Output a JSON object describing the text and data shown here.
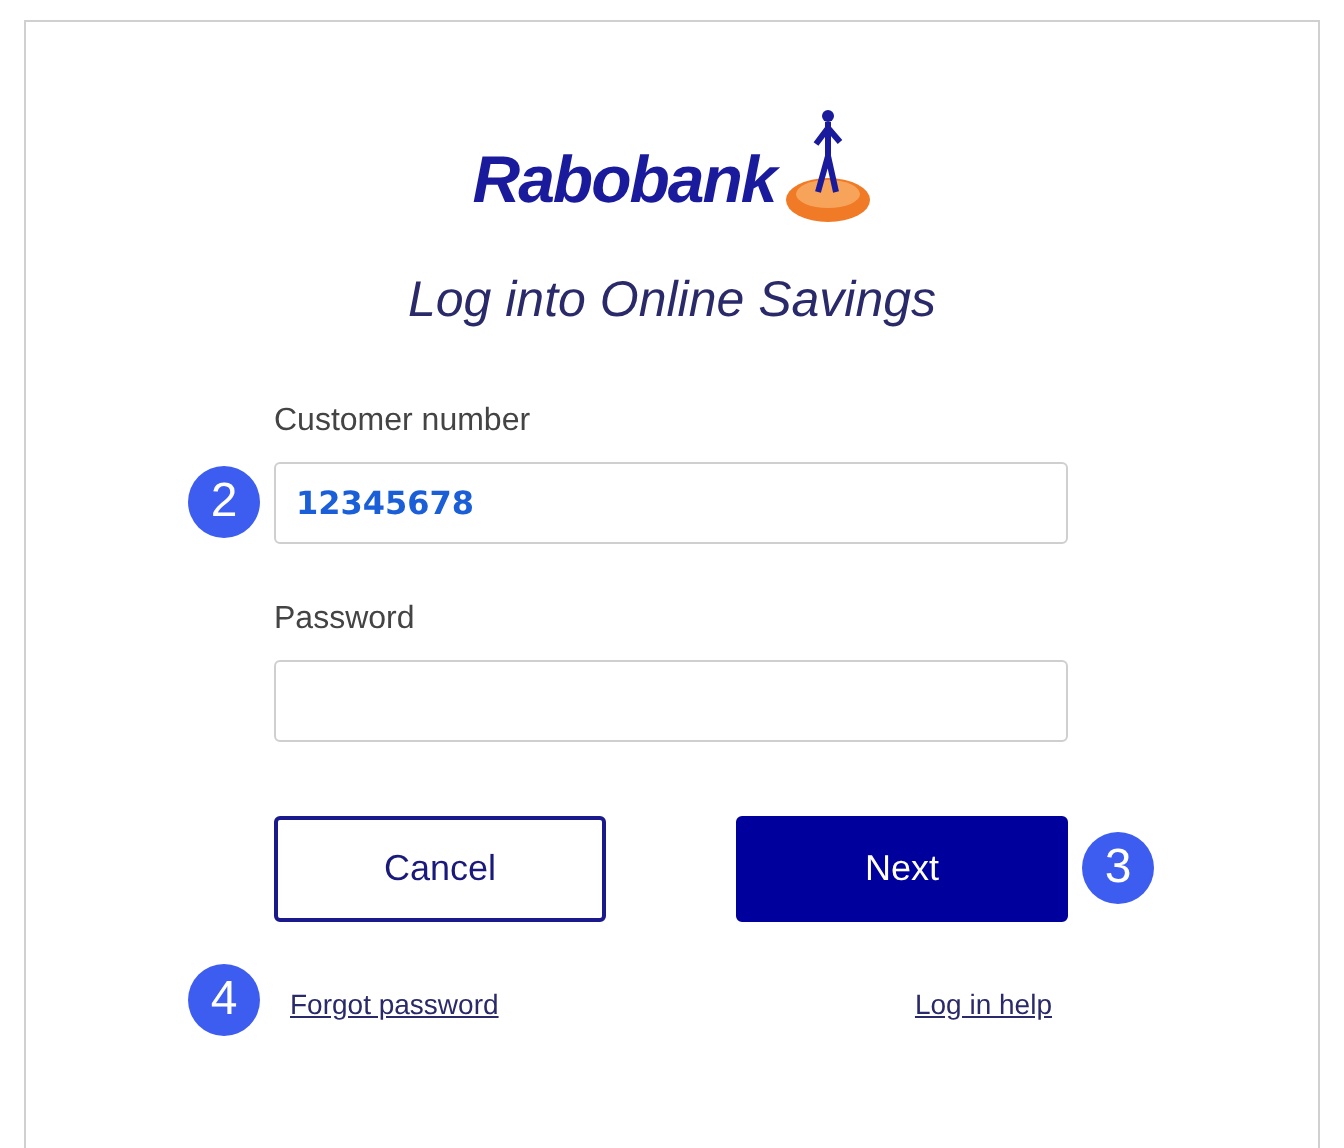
{
  "logo": {
    "text": "Rabobank"
  },
  "title": "Log into Online Savings",
  "fields": [
    {
      "label": "Customer number",
      "value": "12345678",
      "marker": "2"
    },
    {
      "label": "Password"
    }
  ],
  "buttons": [
    {
      "label": "Cancel",
      "kind": "secondary"
    },
    {
      "label": "Next",
      "kind": "primary",
      "marker": "3"
    }
  ],
  "links": [
    {
      "label": "Forgot password",
      "marker": "4"
    },
    {
      "label": "Log in help"
    }
  ]
}
